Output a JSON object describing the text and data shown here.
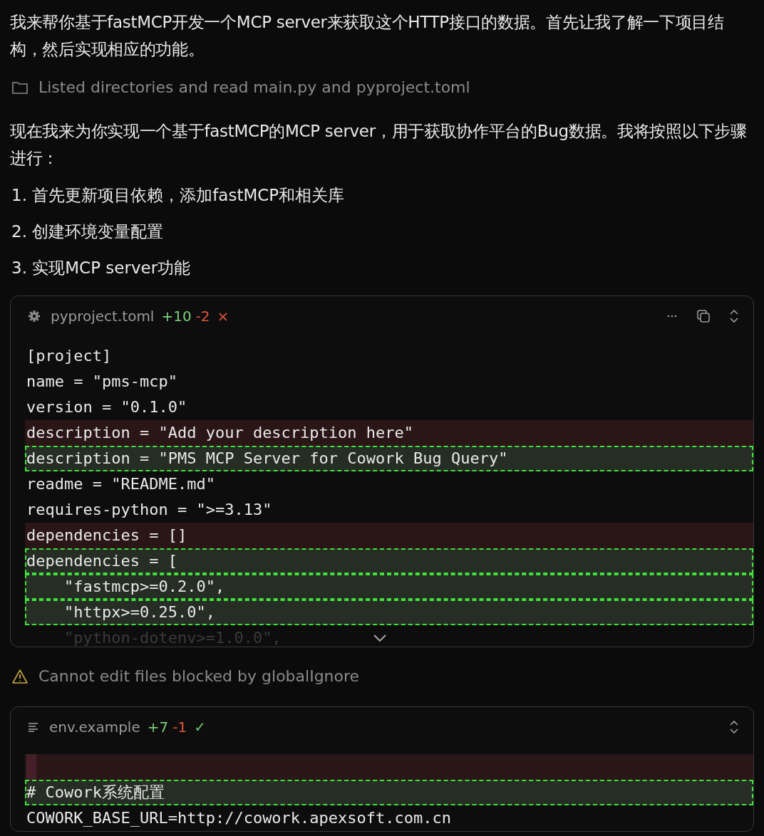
{
  "blocks": [
    {
      "kind": "paragraph",
      "text": "我来帮你基于fastMCP开发一个MCP server来获取这个HTTP接口的数据。首先让我了解一下项目结构，然后实现相应的功能。"
    },
    {
      "kind": "listing_note",
      "text": "Listed directories and read main.py and pyproject.toml"
    },
    {
      "kind": "paragraph",
      "text": "现在我来为你实现一个基于fastMCP的MCP server，用于获取协作平台的Bug数据。我将按照以下步骤进行："
    },
    {
      "kind": "list_item",
      "text": "1. 首先更新项目依赖，添加fastMCP和相关库"
    },
    {
      "kind": "list_item",
      "text": "2. 创建环境变量配置"
    },
    {
      "kind": "list_item",
      "text": "3. 实现MCP server功能"
    },
    {
      "kind": "config_diff",
      "file": "pyproject.toml",
      "added": "+10",
      "removed": "-2",
      "status": "×",
      "accepted": false,
      "collapsed": true,
      "lines": [
        {
          "kind": "context",
          "text": "[project]"
        },
        {
          "kind": "context",
          "text": "name = \"pms-mcp\""
        },
        {
          "kind": "context",
          "text": "version = \"0.1.0\""
        },
        {
          "kind": "removed",
          "text": "description = \"Add your description here\""
        },
        {
          "kind": "added",
          "text": "description = \"PMS MCP Server for Cowork Bug Query\""
        },
        {
          "kind": "context",
          "text": "readme = \"README.md\""
        },
        {
          "kind": "context",
          "text": "requires-python = \">=3.13\""
        },
        {
          "kind": "removed",
          "text": "dependencies = []"
        },
        {
          "kind": "added",
          "text": "dependencies = ["
        },
        {
          "kind": "added",
          "text": "    \"fastmcp>=0.2.0\","
        },
        {
          "kind": "added",
          "text": "    \"httpx>=0.25.0\","
        },
        {
          "kind": "faded",
          "text": "    \"python-dotenv>=1.0.0\","
        }
      ]
    },
    {
      "kind": "warning_note",
      "text": "Cannot edit files blocked by globalIgnore"
    },
    {
      "kind": "text_diff",
      "file": "env.example",
      "added": "+7",
      "removed": "-1",
      "status": "✓",
      "accepted": true,
      "lines": [
        {
          "kind": "removed"
        },
        {
          "kind": "added",
          "text": "# Cowork系统配置"
        },
        {
          "kind": "context",
          "text": "COWORK_BASE_URL=http://cowork.apexsoft.com.cn"
        }
      ]
    }
  ]
}
